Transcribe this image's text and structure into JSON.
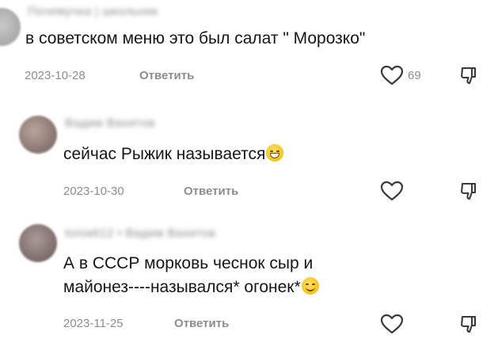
{
  "comments": [
    {
      "username": "Почемучка | школьник",
      "text": "в советском меню это был салат \" Морозко\"",
      "date": "2023-10-28",
      "reply_label": "Ответить",
      "likes": "69"
    },
    {
      "username": "Вадим Вахитов",
      "text": "сейчас Рыжик называется",
      "emoji": "grin-emoji",
      "date": "2023-10-30",
      "reply_label": "Ответить",
      "likes": ""
    },
    {
      "username": "tonia612 • Вадим Вахитов",
      "text_line1": "А в СССР морковь чеснок сыр и",
      "text_line2": "майонез----назывался* огонек*",
      "emoji": "wink-emoji",
      "date": "2023-11-25",
      "reply_label": "Ответить",
      "likes": ""
    }
  ],
  "icons": {
    "like": "heart-outline-icon",
    "dislike": "thumbs-down-outline-icon"
  }
}
